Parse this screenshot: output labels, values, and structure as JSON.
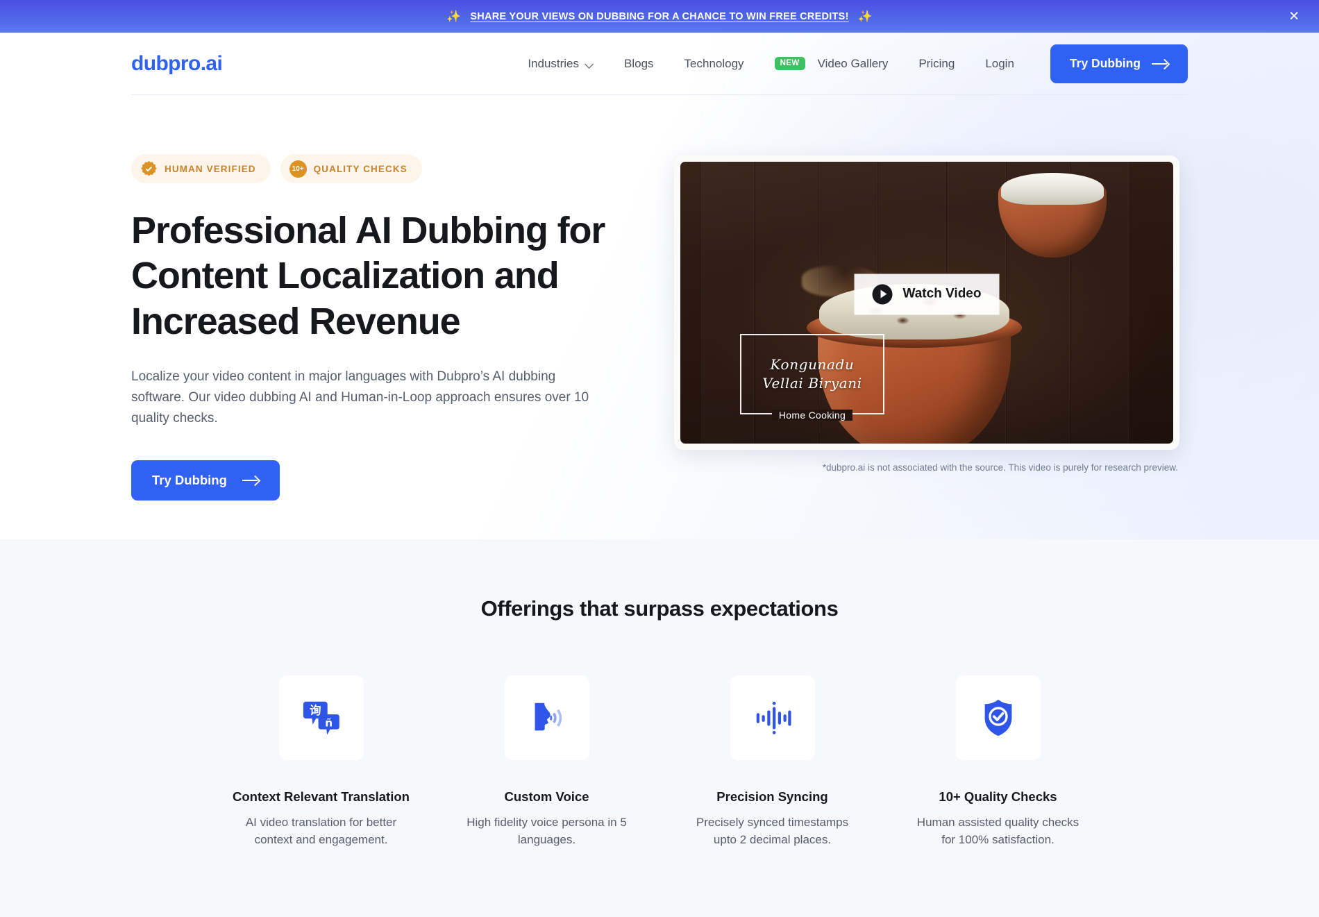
{
  "banner": {
    "text": "SHARE YOUR VIEWS ON DUBBING FOR A CHANCE TO WIN FREE CREDITS!",
    "sparkle_left": "✨",
    "sparkle_right": "✨",
    "close_label": "✕",
    "gradient_from": "#4d4ee0",
    "gradient_to": "#5b79ee"
  },
  "nav": {
    "logo": "dubpro.ai",
    "items": [
      {
        "label": "Industries",
        "has_chevron": true
      },
      {
        "label": "Blogs",
        "has_chevron": false
      },
      {
        "label": "Technology",
        "has_chevron": false
      },
      {
        "label": "Video Gallery",
        "has_chevron": false,
        "badge": "NEW"
      },
      {
        "label": "Pricing",
        "has_chevron": false
      },
      {
        "label": "Login",
        "has_chevron": false
      }
    ],
    "cta_label": "Try Dubbing",
    "accent_color": "#2f62f4",
    "badge_color": "#3fc063"
  },
  "hero": {
    "pills": [
      {
        "label": "HUMAN VERIFIED",
        "icon": "verified-seal-icon"
      },
      {
        "label": "QUALITY CHECKS",
        "icon": "ten-plus-badge-icon",
        "badge_text": "10+"
      }
    ],
    "title": "Professional AI Dubbing for Content Localization and Increased Revenue",
    "subtitle": "Localize your video content in major languages with Dubpro’s AI dubbing software. Our video dubbing AI and Human-in-Loop approach ensures over 10 quality checks.",
    "cta_label": "Try Dubbing",
    "pill_text_color": "#c9822a",
    "pill_bg_color": "#fdf5e9"
  },
  "video": {
    "watch_label": "Watch Video",
    "caption_line1": "Kongunadu",
    "caption_line2": "Vellai Biryani",
    "caption_sub": "Home Cooking",
    "disclaimer": "*dubpro.ai is not associated with the source. This video is purely for research preview."
  },
  "offerings": {
    "heading": "Offerings that surpass expectations",
    "cards": [
      {
        "icon": "translate-chat-bubbles-icon",
        "title": "Context Relevant Translation",
        "desc": "AI video translation for better context and engagement."
      },
      {
        "icon": "speaking-face-icon",
        "title": "Custom Voice",
        "desc": "High fidelity voice persona in 5 languages."
      },
      {
        "icon": "audio-waveform-icon",
        "title": "Precision Syncing",
        "desc": "Precisely synced timestamps upto 2 decimal places."
      },
      {
        "icon": "shield-check-icon",
        "title": "10+ Quality Checks",
        "desc": "Human assisted quality checks for 100% satisfaction."
      }
    ],
    "bg_color": "#f6f8fc",
    "icon_color": "#2f55e8"
  }
}
